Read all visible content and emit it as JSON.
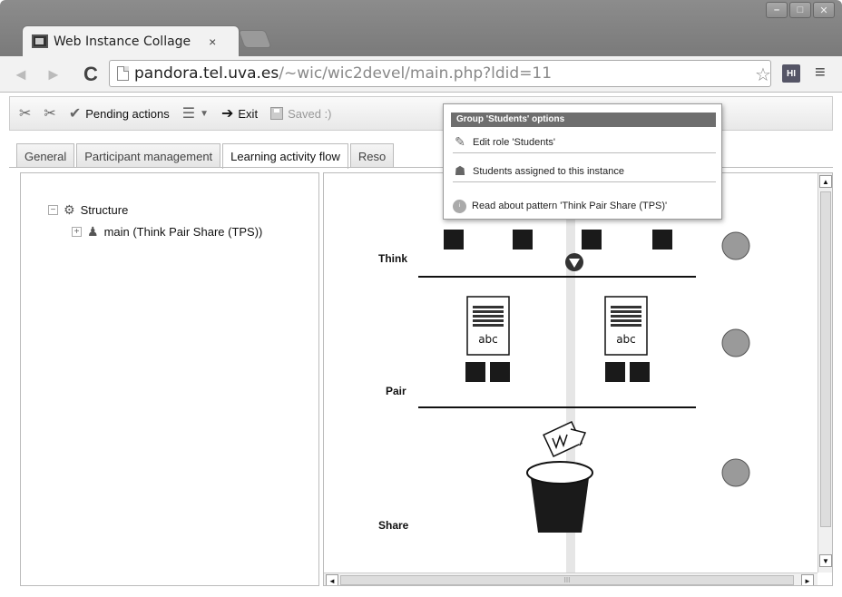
{
  "browser": {
    "tab_title": "Web Instance Collage",
    "tab_close": "×",
    "url_host": "pandora.tel.uva.es",
    "url_path": "/~wic/wic2devel/main.php?ldid=11",
    "extension_label": "HI"
  },
  "toolbar": {
    "pending_label": "Pending actions",
    "exit_label": "Exit",
    "saved_label": "Saved :)"
  },
  "tabs": [
    {
      "label": "General"
    },
    {
      "label": "Participant management"
    },
    {
      "label": "Learning activity flow"
    },
    {
      "label": "Reso"
    }
  ],
  "tree": {
    "root_label": "Structure",
    "child_label": "main (Think Pair Share (TPS))"
  },
  "popup": {
    "header": "Group 'Students' options",
    "items": [
      {
        "label": "Edit role 'Students'",
        "icon": "pencil-icon"
      },
      {
        "label": "Students assigned to this instance",
        "icon": "users-icon"
      },
      {
        "label": "Read about pattern 'Think Pair Share (TPS)'",
        "icon": "info-icon"
      }
    ]
  },
  "diagram": {
    "phases": [
      {
        "label": "Think"
      },
      {
        "label": "Pair"
      },
      {
        "label": "Share"
      }
    ],
    "doc_label": "abc",
    "hscroll_grip": "III"
  }
}
